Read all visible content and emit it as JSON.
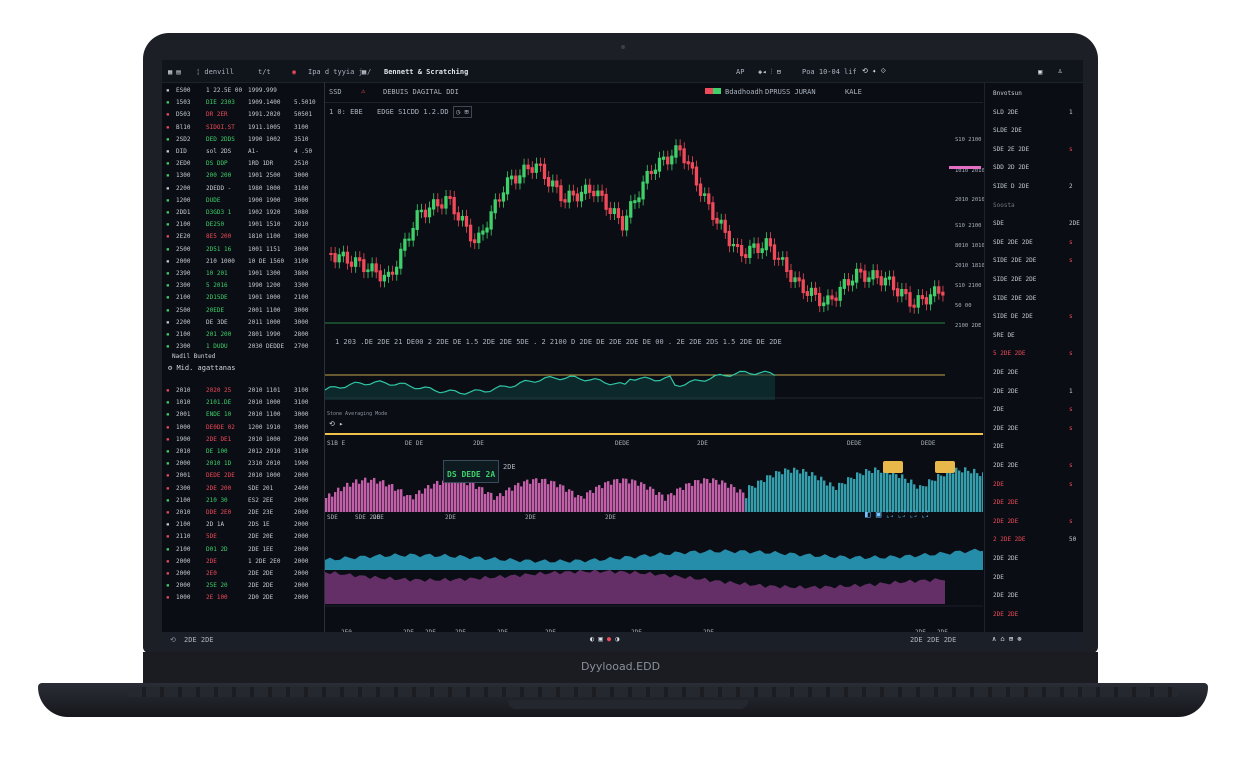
{
  "brand": "Dyylooad.EDD",
  "topbar": {
    "app_title": "Bennett & Scratching",
    "left_items": [
      "¦ denvill",
      "t/t",
      "Ipa d tyyia j /"
    ],
    "right_items": [
      "AP",
      "Poa 10-04",
      "lif"
    ]
  },
  "chart_header": {
    "ticker": "SSD",
    "tabs": [
      "DEBUIS DAGITAL DDI",
      "Bdadhoadh",
      "DPRUSS JURAN",
      "KALE"
    ],
    "toolbar_text": "1 0: EBE",
    "price_text": "EDGE S1CDD 1.2.DD"
  },
  "left_panel": {
    "section_title": "Nadil Bunted",
    "section_subtitle": "Mid. agattanas",
    "rows_top": [
      {
        "sym": "ES00",
        "a": "1 22.5E 00",
        "b": "1999.999",
        "c": "",
        "col": "w"
      },
      {
        "sym": "1503",
        "a": "DIE 2303",
        "b": "1909.1400",
        "c": "5.5010",
        "col": "g"
      },
      {
        "sym": "D503",
        "a": "DR 2ER",
        "b": "1991.2020",
        "c": "50501",
        "col": "r"
      },
      {
        "sym": "Bl10",
        "a": "SIDOI.ST",
        "b": "1911.1005",
        "c": "3100",
        "col": "r"
      },
      {
        "sym": "2SD2",
        "a": "DED 2DDS",
        "b": "1990 1002",
        "c": "3510",
        "col": "g"
      },
      {
        "sym": "DID",
        "a": "sol 2DS",
        "b": "A1-",
        "c": "4 .50",
        "col": "w"
      },
      {
        "sym": "2ED0",
        "a": "DS DDP",
        "b": "1RD 1DR",
        "c": "2510",
        "col": "g"
      },
      {
        "sym": "1300",
        "a": "200 200",
        "b": "1901 2500",
        "c": "3000",
        "col": "g"
      },
      {
        "sym": "2200",
        "a": "2DEDD -",
        "b": "1980 1000",
        "c": "3100",
        "col": "w"
      },
      {
        "sym": "1200",
        "a": "DUDE",
        "b": "1900 1900",
        "c": "3000",
        "col": "g"
      },
      {
        "sym": "2DD1",
        "a": "D3GD3 1",
        "b": "1902 1920",
        "c": "3080",
        "col": "g"
      },
      {
        "sym": "2100",
        "a": "DE250",
        "b": "1901 1510",
        "c": "2810",
        "col": "g"
      },
      {
        "sym": "2E20",
        "a": "8E5 200",
        "b": "1810 1100",
        "c": "3000",
        "col": "r"
      },
      {
        "sym": "2500",
        "a": "2D51 16",
        "b": "1001 1151",
        "c": "3000",
        "col": "g"
      },
      {
        "sym": "2000",
        "a": "210 1000",
        "b": "10 DE 1560",
        "c": "3100",
        "col": "w"
      },
      {
        "sym": "2390",
        "a": "10 201",
        "b": "1901 1300",
        "c": "3800",
        "col": "g"
      },
      {
        "sym": "2300",
        "a": "5 2016",
        "b": "1990 1200",
        "c": "3300",
        "col": "g"
      },
      {
        "sym": "2100",
        "a": "2D15DE",
        "b": "1901 1000",
        "c": "2100",
        "col": "g"
      },
      {
        "sym": "2500",
        "a": "20EDE",
        "b": "2001 1100",
        "c": "3000",
        "col": "g"
      },
      {
        "sym": "2200",
        "a": "DE 3DE",
        "b": "2011 1000",
        "c": "3000",
        "col": "w"
      },
      {
        "sym": "2100",
        "a": "201 200",
        "b": "2801 1990",
        "c": "2800",
        "col": "g"
      },
      {
        "sym": "2300",
        "a": "1 DUDU",
        "b": "2030 DEDDE",
        "c": "2700",
        "col": "g"
      }
    ],
    "rows_bottom": [
      {
        "sym": "2010",
        "a": "2020 25",
        "b": "2010 1101",
        "c": "3100",
        "col": "r"
      },
      {
        "sym": "1010",
        "a": "2101.DE",
        "b": "2010 1000",
        "c": "3100",
        "col": "g"
      },
      {
        "sym": "2001",
        "a": "ENDE 10",
        "b": "2010 1100",
        "c": "3000",
        "col": "g"
      },
      {
        "sym": "1000",
        "a": "DE0DE 02",
        "b": "1200 1910",
        "c": "3000",
        "col": "r"
      },
      {
        "sym": "1900",
        "a": "2DE DE1",
        "b": "2010 1000",
        "c": "2000",
        "col": "r"
      },
      {
        "sym": "2010",
        "a": "DE 100",
        "b": "2012 2910",
        "c": "3100",
        "col": "g"
      },
      {
        "sym": "2000",
        "a": "2010 1D",
        "b": "2310 2010",
        "c": "1900",
        "col": "g"
      },
      {
        "sym": "2001",
        "a": "DEDE 2DE",
        "b": "2010 1000",
        "c": "2000",
        "col": "r"
      },
      {
        "sym": "2300",
        "a": "2DE 200",
        "b": "SDE 201",
        "c": "2400",
        "col": "r"
      },
      {
        "sym": "2100",
        "a": "210 30",
        "b": "ES2 2EE",
        "c": "2000",
        "col": "g"
      },
      {
        "sym": "2010",
        "a": "DDE 2E0",
        "b": "2DE 23E",
        "c": "2000",
        "col": "r"
      },
      {
        "sym": "2100",
        "a": "2D 1A",
        "b": "2DS 1E",
        "c": "2000",
        "col": "w"
      },
      {
        "sym": "2110",
        "a": "5DE",
        "b": "2DE 20E",
        "c": "2000",
        "col": "r"
      },
      {
        "sym": "2100",
        "a": "D01 2D",
        "b": "2DE 1EE",
        "c": "2000",
        "col": "g"
      },
      {
        "sym": "2000",
        "a": "2DE",
        "b": "1 2DE 2E0",
        "c": "2000",
        "col": "r"
      },
      {
        "sym": "2000",
        "a": "2E0",
        "b": "2DE 2DE",
        "c": "2000",
        "col": "r"
      },
      {
        "sym": "2000",
        "a": "25E 20",
        "b": "2DE 2DE",
        "c": "2000",
        "col": "g"
      },
      {
        "sym": "1000",
        "a": "2E 100",
        "b": "2D0 2DE",
        "c": "2000",
        "col": "r"
      }
    ]
  },
  "axis_right_labels": [
    "S10 2100",
    "1010 2010",
    "2010 2010",
    "S10 2100",
    "8010 1010",
    "2010 1810",
    "S10 2100",
    "50 00",
    "2100 2DE"
  ],
  "indicator_strip": "1 203 .DE 2DE 21  DE00  2 2DE DE 1.5 2DE 2DE 5DE . 2 2100  D 2DE DE  2DE 2DE DE 00  . 2E 2DE  2DS 1.5 2DE DE 2DE",
  "panel_labels": {
    "osc_label": "Stone Averaging Mode",
    "cat_tabs": [
      "S1B E",
      "DE DE",
      "2DE",
      "DEDE",
      "2DE",
      "DEDE",
      "DEDE"
    ],
    "volume_badge": "DS DEDE 2A",
    "volume_badge_right": "2DE",
    "vol_axis": [
      "SDE",
      "SDE 2DE",
      "2DE",
      "2DE",
      "2DE",
      "2DE"
    ],
    "bottom_axis": [
      "2E0",
      "2DE",
      "2DE",
      "2DE",
      "2DE",
      "2DE",
      "2DE",
      "2DE",
      "2DE",
      "2DE"
    ]
  },
  "right_panel": {
    "items": [
      {
        "t": "Bnvotsun",
        "v": "",
        "col": "w"
      },
      {
        "t": "SLD 2DE",
        "v": "1",
        "col": "w"
      },
      {
        "t": "SLDE 2DE",
        "v": "",
        "col": "w"
      },
      {
        "t": "SDE 2E 2DE",
        "v": "s",
        "col": "w"
      },
      {
        "t": "SDD 2D 2DE",
        "v": "",
        "col": "w"
      },
      {
        "t": "SIDE D 2DE",
        "v": "2",
        "col": "w"
      },
      {
        "t": "Soosta",
        "v": "",
        "col": "dim"
      },
      {
        "t": "SDE",
        "v": "2DE",
        "col": "w"
      },
      {
        "t": "SDE 2DE 2DE",
        "v": "s",
        "col": "w"
      },
      {
        "t": "SIDE 2DE 2DE",
        "v": "s",
        "col": "w"
      },
      {
        "t": "SIDE 2DE 2DE",
        "v": "",
        "col": "w"
      },
      {
        "t": "SIDE 2DE 2DE",
        "v": "",
        "col": "w"
      },
      {
        "t": "SIDE DE 2DE",
        "v": "s",
        "col": "w"
      },
      {
        "t": "SRE DE",
        "v": "",
        "col": "w"
      },
      {
        "t": "5 2DE 2DE",
        "v": "s",
        "col": "r"
      },
      {
        "t": "2DE 2DE",
        "v": "",
        "col": "w"
      },
      {
        "t": "2DE 2DE",
        "v": "1",
        "col": "w"
      },
      {
        "t": "2DE",
        "v": "s",
        "col": "w"
      },
      {
        "t": "2DE 2DE",
        "v": "s",
        "col": "w"
      },
      {
        "t": "2DE",
        "v": "",
        "col": "w"
      },
      {
        "t": "2DE 2DE",
        "v": "s",
        "col": "w"
      },
      {
        "t": "2DE",
        "v": "s",
        "col": "r"
      },
      {
        "t": "2DE 2DE",
        "v": "",
        "col": "r"
      },
      {
        "t": "2DE 2DE",
        "v": "s",
        "col": "r"
      },
      {
        "t": "2 2DE 2DE",
        "v": "50",
        "col": "r"
      },
      {
        "t": "2DE 2DE",
        "v": "",
        "col": "w"
      },
      {
        "t": "2DE",
        "v": "",
        "col": "w"
      },
      {
        "t": "2DE 2DE",
        "v": "",
        "col": "w"
      },
      {
        "t": "2DE 2DE",
        "v": "",
        "col": "r"
      }
    ]
  },
  "dock": {
    "left_text": "2DE 2DE",
    "right_text": "2DE 2DE 2DE"
  },
  "colors": {
    "up": "#3fd06b",
    "down": "#ef4a5a",
    "accent": "#f0c24b",
    "pink": "#e46fc4",
    "teal": "#3cb9c9"
  }
}
